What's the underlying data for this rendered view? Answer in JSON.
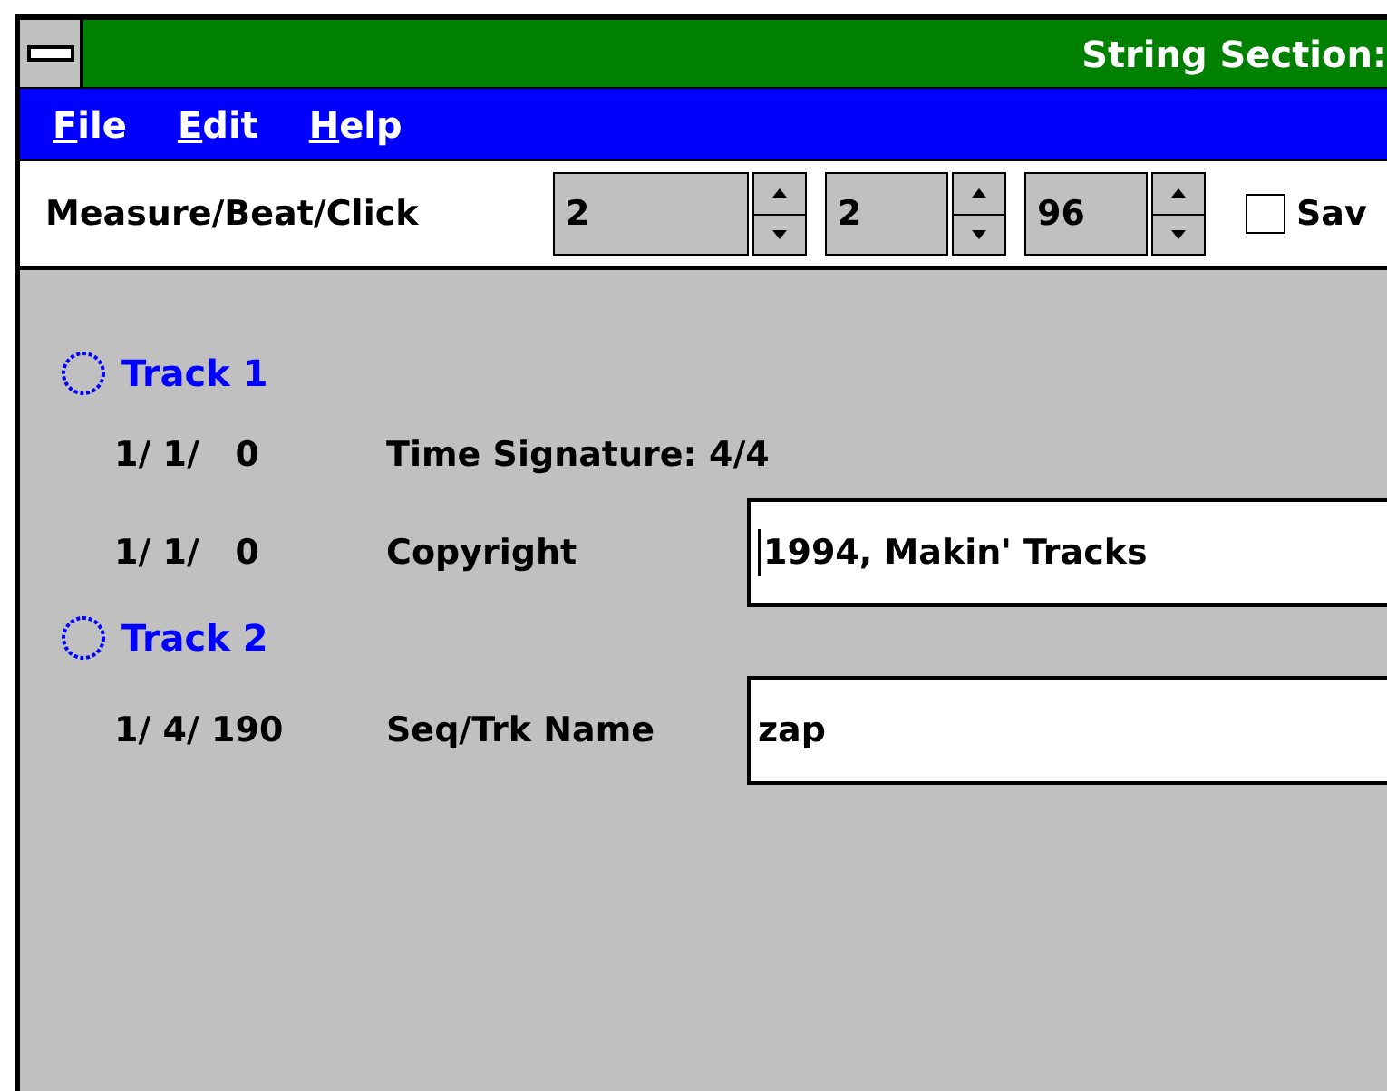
{
  "window": {
    "title": "String Section:"
  },
  "menu": [
    {
      "label": "File"
    },
    {
      "label": "Edit"
    },
    {
      "label": "Help"
    }
  ],
  "toolbar": {
    "label": "Measure/Beat/Click",
    "spinners": [
      {
        "value": "2"
      },
      {
        "value": "2"
      },
      {
        "value": "96"
      }
    ],
    "checkbox": {
      "label": "Sav",
      "checked": false
    }
  },
  "tracks": [
    {
      "name": "Track 1",
      "selected": false,
      "events": [
        {
          "time": "1/ 1/   0",
          "kind": "text",
          "label": "Time Signature: 4/4"
        },
        {
          "time": "1/ 1/   0",
          "kind": "field",
          "label": "Copyright",
          "value": "1994, Makin' Tracks",
          "focused": true
        }
      ]
    },
    {
      "name": "Track 2",
      "selected": false,
      "events": [
        {
          "time": "1/ 4/ 190",
          "kind": "field",
          "label": "Seq/Trk Name",
          "value": "zap",
          "focused": false
        }
      ]
    }
  ]
}
